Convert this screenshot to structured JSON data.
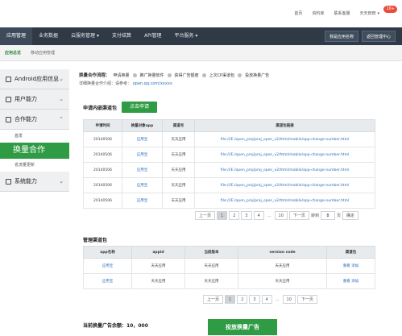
{
  "topbar": {
    "links": [
      "首页",
      "资料库",
      "联系客服"
    ],
    "user": "天天田田",
    "notif": "10+"
  },
  "nav": {
    "tabs": [
      "应用管理",
      "业务数据",
      "云服务管理 ▾",
      "支付结算",
      "API管理",
      "平台服务 ▾"
    ],
    "btn1": "我是应用名称",
    "btn2": "返回管理中心"
  },
  "sub": {
    "tabs": [
      "应用总览",
      "移动应用管理"
    ]
  },
  "sidebar": {
    "items": [
      "Android应用信息",
      "用户能力",
      "合作能力",
      "系统能力"
    ],
    "subs": [
      "首发",
      "换量合作",
      "省流量更新"
    ]
  },
  "flow": {
    "label": "换量合作流程：",
    "steps": [
      "申请换量",
      "推广换量软件",
      "获得广告额度",
      "上次CP渠道包",
      "投放换量广告"
    ]
  },
  "doc": {
    "label": "详细换量合作介绍：请参考：",
    "link": "open.qq.com/xxxxx"
  },
  "section1": {
    "title": "申请内嵌渠道包",
    "button": "点击申请",
    "headers": [
      "申请时间",
      "换量对象app",
      "渠道号",
      "渠道包链接"
    ],
    "rows": [
      [
        "20140506",
        "应用宝",
        "天天应用",
        "file:///E:/open_proj/proj_open_v2/html/mobile/app-change-number.html"
      ],
      [
        "20140506",
        "应用宝",
        "天天应用",
        "file:///E:/open_proj/proj_open_v2/html/mobile/app-change-number.html"
      ],
      [
        "20140506",
        "应用宝",
        "天天应用",
        "file:///E:/open_proj/proj_open_v2/html/mobile/app-change-number.html"
      ],
      [
        "20140506",
        "应用宝",
        "天天应用",
        "file:///E:/open_proj/proj_open_v2/html/mobile/app-change-number.html"
      ],
      [
        "20140506",
        "应用宝",
        "天天应用",
        "file:///E:/open_proj/proj_open_v2/html/mobile/app-change-number.html"
      ]
    ]
  },
  "pager1": {
    "prev": "上一页",
    "pages": [
      "1",
      "2",
      "3",
      "4"
    ],
    "ellipsis": "...",
    "last": "10",
    "next": "下一页",
    "goto": "转到",
    "page_value": "8",
    "unit": "页",
    "ok": "确定"
  },
  "section2": {
    "title": "管理渠道包",
    "headers": [
      "app名称",
      "appid",
      "当前版本",
      "version code",
      "渠道包"
    ],
    "rows": [
      [
        "应用宝",
        "天天应用",
        "天天应用",
        "天天应用",
        "重看",
        "添加"
      ],
      [
        "应用宝",
        "天天应用",
        "天天应用",
        "天天应用",
        "重看",
        "添加"
      ]
    ]
  },
  "pager2": {
    "prev": "上一页",
    "pages": [
      "1",
      "2",
      "3",
      "4"
    ],
    "ellipsis": "...",
    "last": "10",
    "next": "下一页"
  },
  "footer": {
    "balance": "当前换量广告余额：10，000",
    "button": "投放换量广告"
  }
}
